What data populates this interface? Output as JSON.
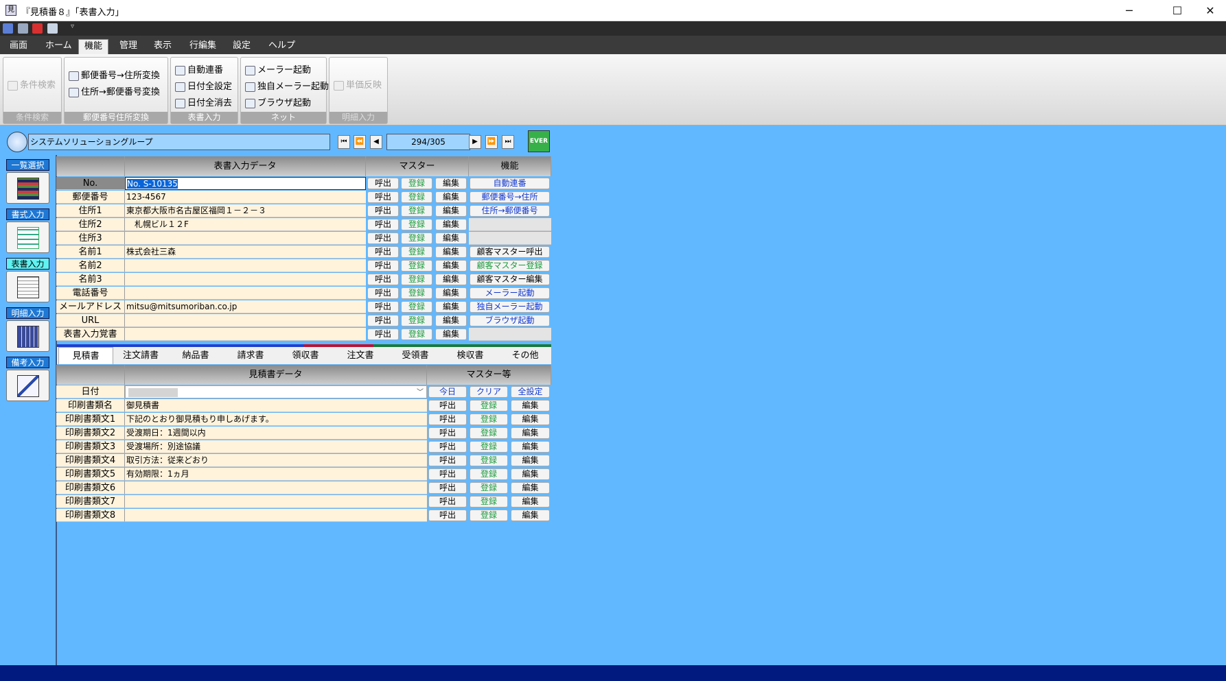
{
  "window": {
    "title": "『見積番８』「表書入力」",
    "minimize": "─",
    "maximize": "☐",
    "close": "✕"
  },
  "quick_access": {
    "icons": [
      "save-icon",
      "print-icon",
      "pdf-icon",
      "preview-icon"
    ],
    "more": "▿"
  },
  "menu": {
    "items": [
      "画面",
      "ホーム",
      "機能",
      "管理",
      "表示",
      "行編集",
      "設定",
      "ヘルプ"
    ],
    "active": "機能"
  },
  "ribbon": {
    "search": {
      "button": "条件検索",
      "group": "条件検索"
    },
    "postal": {
      "to_address": "郵便番号→住所変換",
      "to_postal": "住所→郵便番号変換",
      "group": "郵便番号住所変換"
    },
    "cover": {
      "auto_number": "自動連番",
      "date_all_set": "日付全設定",
      "date_all_clear": "日付全消去",
      "group": "表書入力"
    },
    "net": {
      "mailer": "メーラー起動",
      "own_mailer": "独自メーラー起動",
      "browser": "ブラウザ起動",
      "group": "ネット"
    },
    "detail": {
      "price_reflect": "単価反映",
      "group": "明細入力"
    }
  },
  "record": {
    "company": "システムソリューショングループ",
    "position": "294/305",
    "ever_label": "EVER"
  },
  "left_nav": [
    "一覧選択",
    "書式入力",
    "表書入力",
    "明細入力",
    "備考入力"
  ],
  "cover_grid": {
    "headers": {
      "data": "表書入力データ",
      "master": "マスター",
      "function": "機能"
    },
    "rows": [
      {
        "label": "No.",
        "value": "No. S-10135",
        "func": "自動連番"
      },
      {
        "label": "郵便番号",
        "value": "123-4567",
        "func": "郵便番号→住所"
      },
      {
        "label": "住所1",
        "value": "東京都大阪市名古屋区福岡１－２－３",
        "func": "住所→郵便番号"
      },
      {
        "label": "住所2",
        "value": "　札幌ビル１２F",
        "func": ""
      },
      {
        "label": "住所3",
        "value": "",
        "func": ""
      },
      {
        "label": "名前1",
        "value": "株式会社三森",
        "func": "顧客マスター呼出"
      },
      {
        "label": "名前2",
        "value": "",
        "func": "顧客マスター登録"
      },
      {
        "label": "名前3",
        "value": "",
        "func": "顧客マスター編集"
      },
      {
        "label": "電話番号",
        "value": "",
        "func": "メーラー起動"
      },
      {
        "label": "メールアドレス",
        "value": "mitsu@mitsumoriban.co.jp",
        "func": "独自メーラー起動"
      },
      {
        "label": "URL",
        "value": "",
        "func": "ブラウザ起動"
      },
      {
        "label": "表書入力覚書",
        "value": "",
        "func": ""
      }
    ],
    "btn_call": "呼出",
    "btn_register": "登録",
    "btn_edit": "編集"
  },
  "tabs": {
    "items": [
      "見積書",
      "注文請書",
      "納品書",
      "請求書",
      "領収書",
      "注文書",
      "受領書",
      "検収書",
      "その他"
    ],
    "active": "見積書"
  },
  "estimate_grid": {
    "headers": {
      "data": "見積書データ",
      "master": "マスター等"
    },
    "date_row": {
      "label": "日付",
      "value": "",
      "today": "今日",
      "clear": "クリア",
      "all_set": "全設定"
    },
    "rows": [
      {
        "label": "印刷書類名",
        "value": "御見積書"
      },
      {
        "label": "印刷書類文1",
        "value": "下記のとおり御見積もり申しあげます。"
      },
      {
        "label": "印刷書類文2",
        "value": "受渡期日：1週間以内"
      },
      {
        "label": "印刷書類文3",
        "value": "受渡場所：別途協議"
      },
      {
        "label": "印刷書類文4",
        "value": "取引方法：従来どおり"
      },
      {
        "label": "印刷書類文5",
        "value": "有効期限：1ヵ月"
      },
      {
        "label": "印刷書類文6",
        "value": ""
      },
      {
        "label": "印刷書類文7",
        "value": ""
      },
      {
        "label": "印刷書類文8",
        "value": ""
      }
    ]
  }
}
